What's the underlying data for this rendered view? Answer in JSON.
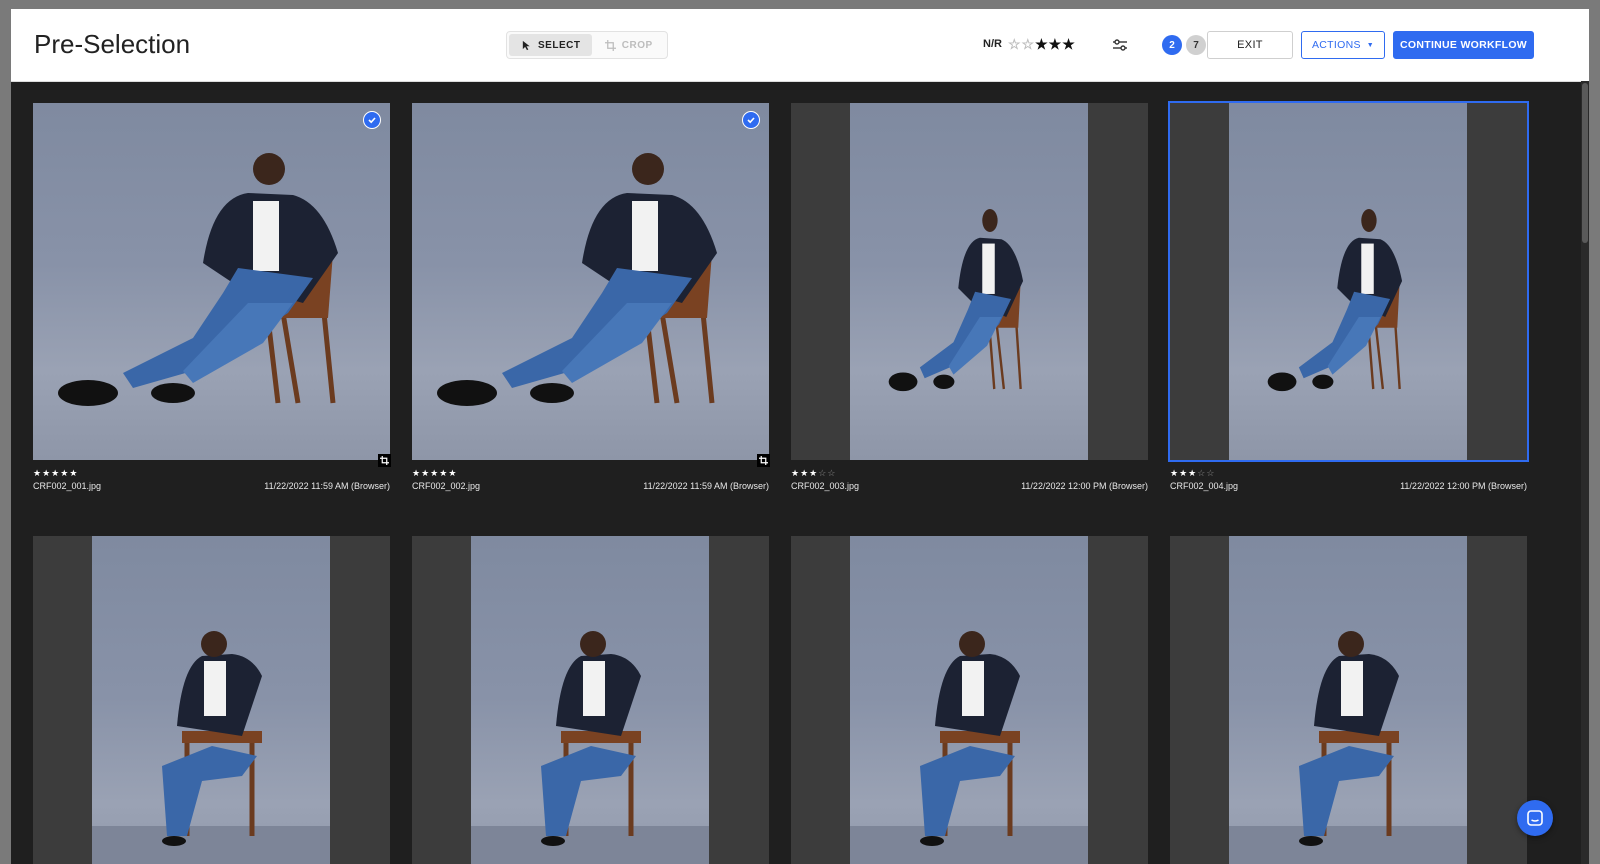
{
  "header": {
    "title": "Pre-Selection",
    "modes": [
      {
        "label": "SELECT",
        "icon": "cursor-icon",
        "active": true
      },
      {
        "label": "CROP",
        "icon": "crop-icon",
        "active": false
      }
    ],
    "rating_filter": {
      "label": "N/R",
      "empty_stars": 2,
      "full_stars": 3
    },
    "filter_icon": "sliders-icon",
    "badge_selected": "2",
    "badge_total": "7",
    "exit_label": "EXIT",
    "actions_label": "ACTIONS",
    "continue_label": "CONTINUE WORKFLOW"
  },
  "colors": {
    "accent": "#2f6bf0",
    "background": "#1f1f1f",
    "header": "#ffffff"
  },
  "photos": [
    {
      "filename": "CRF002_001.jpg",
      "date": "11/22/2022 11:59 AM (Browser)",
      "rating": 5,
      "checked": true,
      "cropped": true,
      "selected": false,
      "framing": "full"
    },
    {
      "filename": "CRF002_002.jpg",
      "date": "11/22/2022 11:59 AM (Browser)",
      "rating": 5,
      "checked": true,
      "cropped": true,
      "selected": false,
      "framing": "full"
    },
    {
      "filename": "CRF002_003.jpg",
      "date": "11/22/2022 12:00 PM (Browser)",
      "rating": 3,
      "checked": false,
      "cropped": false,
      "selected": false,
      "framing": "portrait"
    },
    {
      "filename": "CRF002_004.jpg",
      "date": "11/22/2022 12:00 PM (Browser)",
      "rating": 3,
      "checked": false,
      "cropped": false,
      "selected": true,
      "framing": "portrait"
    },
    {
      "filename": "",
      "date": "",
      "rating": 0,
      "checked": false,
      "cropped": false,
      "selected": false,
      "framing": "portrait"
    },
    {
      "filename": "",
      "date": "",
      "rating": 0,
      "checked": false,
      "cropped": false,
      "selected": false,
      "framing": "portrait"
    },
    {
      "filename": "",
      "date": "",
      "rating": 0,
      "checked": false,
      "cropped": false,
      "selected": false,
      "framing": "portrait"
    },
    {
      "filename": "",
      "date": "",
      "rating": 0,
      "checked": false,
      "cropped": false,
      "selected": false,
      "framing": "portrait"
    }
  ],
  "chat_icon": "chat-icon"
}
